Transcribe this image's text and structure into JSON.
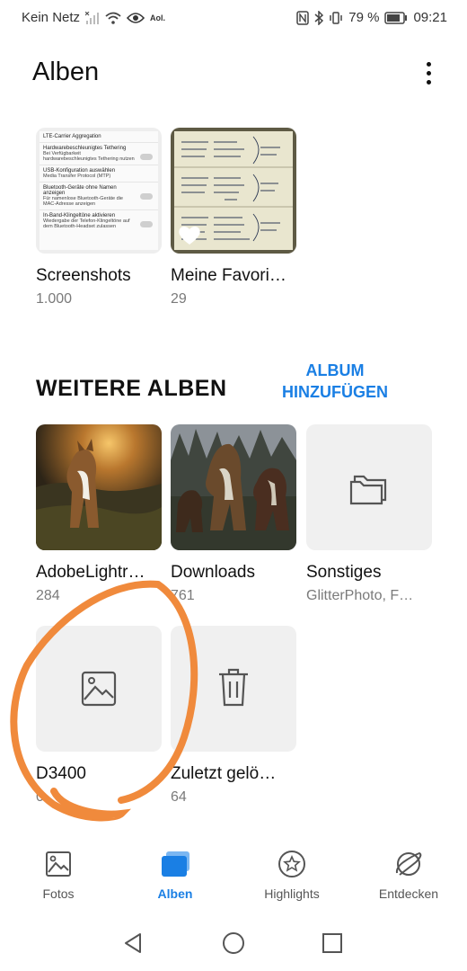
{
  "status_bar": {
    "carrier": "Kein Netz",
    "aol": "Aol.",
    "battery": "79 %",
    "time": "09:21"
  },
  "header": {
    "title": "Alben",
    "menu_icon": "more-vertical-icon"
  },
  "top_albums": [
    {
      "name": "Screenshots",
      "count": "1.000"
    },
    {
      "name": "Meine Favori…",
      "count": "29"
    }
  ],
  "screenshot_preview": {
    "rows": [
      {
        "title": "LTE-Carrier Aggregation",
        "sub": ""
      },
      {
        "title": "Hardwarebeschleunigtes Tethering",
        "sub": "Bei Verfügbarkeit hardwarebeschleunigtes Tethering nutzen"
      },
      {
        "title": "USB-Konfiguration auswählen",
        "sub": "Media Transfer Protocol (MTP)"
      },
      {
        "title": "Bluetooth-Geräte ohne Namen anzeigen",
        "sub": "Für namenlose Bluetooth-Geräte die MAC-Adresse anzeigen"
      },
      {
        "title": "In-Band-Klingeltöne aktivieren",
        "sub": "Wiedergabe der Telefon-Klingeltöne auf dem Bluetooth-Headset zulassen"
      }
    ]
  },
  "more_section": {
    "title": "WEITERE ALBEN",
    "add_line1": "ALBUM",
    "add_line2": "HINZUFÜGEN"
  },
  "more_albums": [
    {
      "name": "AdobeLightr…",
      "count": "284"
    },
    {
      "name": "Downloads",
      "count": "761"
    },
    {
      "name": "Sonstiges",
      "count": "GlitterPhoto, F…"
    },
    {
      "name": "D3400",
      "count": "0"
    },
    {
      "name": "Zuletzt gelö…",
      "count": "64"
    }
  ],
  "bottom_nav": [
    {
      "label": "Fotos",
      "icon": "image-icon"
    },
    {
      "label": "Alben",
      "icon": "albums-icon"
    },
    {
      "label": "Highlights",
      "icon": "star-circle-icon"
    },
    {
      "label": "Entdecken",
      "icon": "discover-icon"
    }
  ],
  "colors": {
    "accent": "#1a7fe4",
    "annotation": "#f08a3c"
  }
}
